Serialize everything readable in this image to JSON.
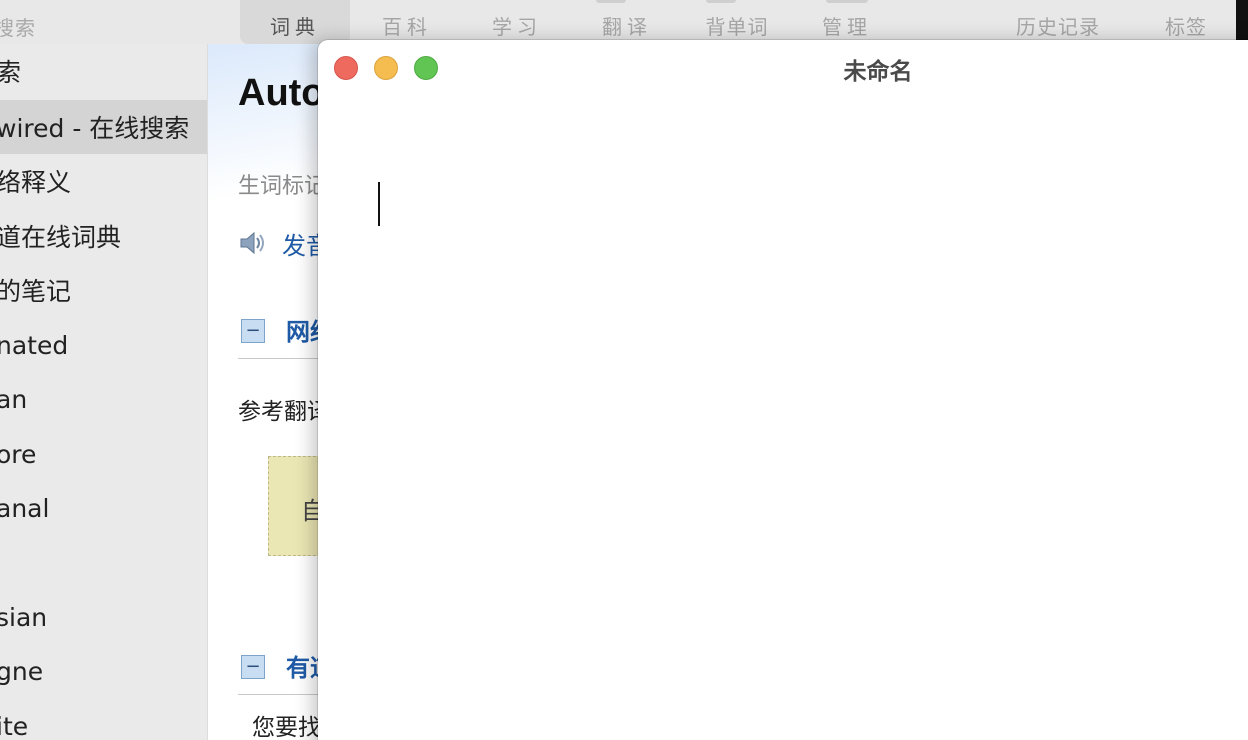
{
  "toolbar": {
    "search_hint": "搜索",
    "tabs": [
      {
        "label": "词典",
        "active": true
      },
      {
        "label": "百科",
        "active": false
      },
      {
        "label": "学习",
        "active": false
      },
      {
        "label": "翻译",
        "active": false
      },
      {
        "label": "背单词",
        "active": false
      },
      {
        "label": "管理",
        "active": false
      }
    ],
    "history_label": "历史记录",
    "tags_label": "标签"
  },
  "sidebar": {
    "items": [
      {
        "label": "索",
        "selected": false
      },
      {
        "label": "wired - 在线搜索",
        "selected": true
      },
      {
        "label": "络释义",
        "selected": false
      },
      {
        "label": "道在线词典",
        "selected": false
      },
      {
        "label": "的笔记",
        "selected": false
      },
      {
        "label": "nated",
        "selected": false
      },
      {
        "label": "an",
        "selected": false
      },
      {
        "label": "ore",
        "selected": false
      },
      {
        "label": "anal",
        "selected": false
      },
      {
        "label": "sian",
        "selected": false
      },
      {
        "label": "gne",
        "selected": false
      },
      {
        "label": "ite",
        "selected": false
      }
    ]
  },
  "main": {
    "word_title": "Auto",
    "vocab_label": "生词标记",
    "pronunciation_label": "发音",
    "section_web": "网络",
    "reference_label": "参考翻译",
    "auto_text": "自",
    "section_youdao": "有道",
    "want_label": "您要找"
  },
  "editor": {
    "title": "未命名",
    "content": ""
  },
  "colors": {
    "close": "#ee6a5f",
    "minimize": "#f5bd4f",
    "zoom": "#61c554",
    "link_blue": "#1f5aa6"
  }
}
